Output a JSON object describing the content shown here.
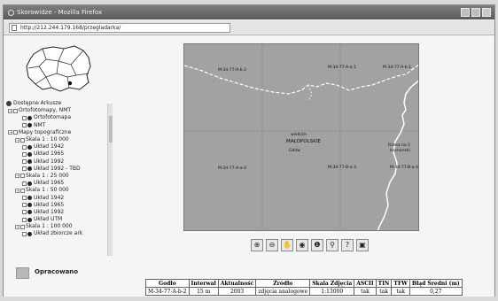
{
  "window": {
    "title": "Skorowidze - Mozilla Firefox"
  },
  "browser": {
    "url": "http://212.244.179.168/przegladarka/"
  },
  "tree": {
    "items": [
      {
        "label": "Dostępne Arkusze",
        "kind": "root"
      },
      {
        "label": "Ortofotomapy, NMT",
        "kind": "group"
      },
      {
        "label": "Ortofotomapa",
        "kind": "layer"
      },
      {
        "label": "NMT",
        "kind": "layer"
      },
      {
        "label": "Mapy topograficzne",
        "kind": "group"
      },
      {
        "label": "Skala 1 : 10 000",
        "kind": "subgroup"
      },
      {
        "label": "Układ 1942",
        "kind": "layer"
      },
      {
        "label": "Układ 1965",
        "kind": "layer"
      },
      {
        "label": "Układ 1992",
        "kind": "layer"
      },
      {
        "label": "Układ 1992 - TBD",
        "kind": "layer"
      },
      {
        "label": "Skala 1 : 25 000",
        "kind": "subgroup"
      },
      {
        "label": "Układ 1965",
        "kind": "layer"
      },
      {
        "label": "Skala 1 : 50 000",
        "kind": "subgroup"
      },
      {
        "label": "Układ 1942",
        "kind": "layer"
      },
      {
        "label": "Układ 1965",
        "kind": "layer"
      },
      {
        "label": "Układ 1992",
        "kind": "layer"
      },
      {
        "label": "Układ UTM",
        "kind": "layer"
      },
      {
        "label": "Skala 1 : 100 000",
        "kind": "subgroup"
      },
      {
        "label": "Układ zbiorcze ark",
        "kind": "layer"
      }
    ]
  },
  "legend": {
    "label": "Opracowano"
  },
  "map": {
    "sheets": [
      "M-34-77-A-b-2",
      "M-34-77-A-a-1",
      "M-34-77-A-b-1",
      "M-34-77-A-a-4",
      "M-34-77-B-a-3",
      "M-34-77-B-a-4"
    ],
    "place_labels": [
      "wielkich",
      "MAŁOPOLSKIE",
      "Gdów",
      "Rzeka na 2",
      "bochenski"
    ]
  },
  "toolbar": {
    "tools": [
      {
        "name": "zoom-in-icon",
        "glyph": "⊕"
      },
      {
        "name": "zoom-out-icon",
        "glyph": "⊖"
      },
      {
        "name": "pan-icon",
        "glyph": "✋"
      },
      {
        "name": "full-extent-icon",
        "glyph": "◉"
      },
      {
        "name": "info-icon",
        "glyph": "❶"
      },
      {
        "name": "find-icon",
        "glyph": "⚲"
      },
      {
        "name": "help-icon",
        "glyph": "?"
      },
      {
        "name": "print-icon",
        "glyph": "▣"
      }
    ]
  },
  "info_table": {
    "headers": [
      "Godło",
      "Interwał",
      "Aktualność",
      "Źródło",
      "Skala Zdjęcia",
      "ASCII",
      "TIN",
      "TFW",
      "Błąd Średni (m)"
    ],
    "row": [
      "M-34-77-A-b-2",
      "15 m",
      "2003",
      "zdjęcia analogowe",
      "1:13000",
      "tak",
      "tak",
      "tak",
      "0,27"
    ]
  }
}
